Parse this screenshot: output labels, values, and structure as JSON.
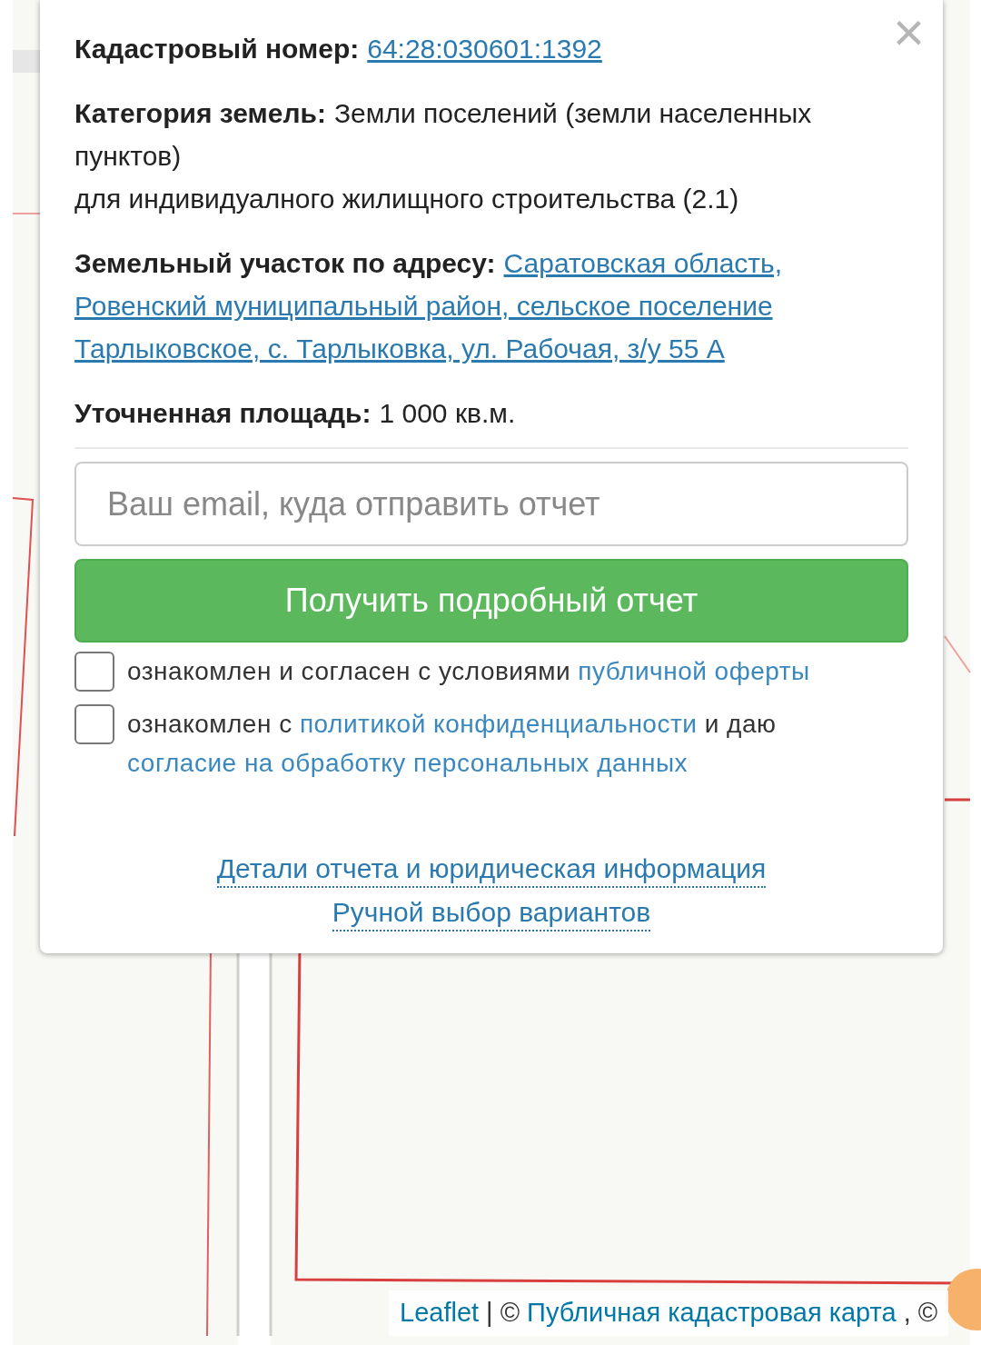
{
  "popup": {
    "close_label": "×",
    "fields": [
      {
        "kind": "link",
        "label": "Кадастровый номер:",
        "value": [
          "64:28:030601:1392"
        ]
      },
      {
        "kind": "text",
        "label": "Категория земель:",
        "value": [
          "Земли поселений (земли населенных",
          "пунктов)"
        ],
        "note": "для индивидуалного жилищного строительства (2.1)"
      },
      {
        "kind": "link",
        "label": "Земельный участок по адресу:",
        "value": [
          "Саратовская область,",
          "Ровенский муниципальный район, сельское поселение",
          "Тарлыковское, с. Тарлыковка, ул. Рабочая, з/у 55 А"
        ]
      },
      {
        "kind": "text",
        "label": "Уточненная площадь:",
        "value": [
          "1 000 кв.м."
        ]
      }
    ],
    "email": {
      "placeholder": "Ваш email, куда отправить отчет"
    },
    "submit": "Получить подробный отчет",
    "agreements": [
      {
        "checked": false,
        "lines": [
          [
            {
              "kind": "text",
              "text": "ознакомлен и согласен с условиями"
            },
            {
              "kind": "link",
              "text": "публичной оферты"
            }
          ]
        ]
      },
      {
        "checked": false,
        "lines": [
          [
            {
              "kind": "text",
              "text": "ознакомлен с"
            },
            {
              "kind": "link",
              "text": "политикой конфиденциальности"
            },
            {
              "kind": "text",
              "text": "и даю"
            }
          ],
          [
            {
              "kind": "link",
              "text": "согласие на обработку персональных данных"
            }
          ]
        ]
      }
    ],
    "links": [
      "Детали отчета и юридическая информация",
      "Ручной выбор вариантов"
    ]
  },
  "attribution": [
    {
      "kind": "link",
      "text": "Leaflet"
    },
    {
      "kind": "text",
      "text": "| ©"
    },
    {
      "kind": "link",
      "text": "Публичная кадастровая карта"
    },
    {
      "kind": "text",
      "text": ", ©"
    }
  ]
}
